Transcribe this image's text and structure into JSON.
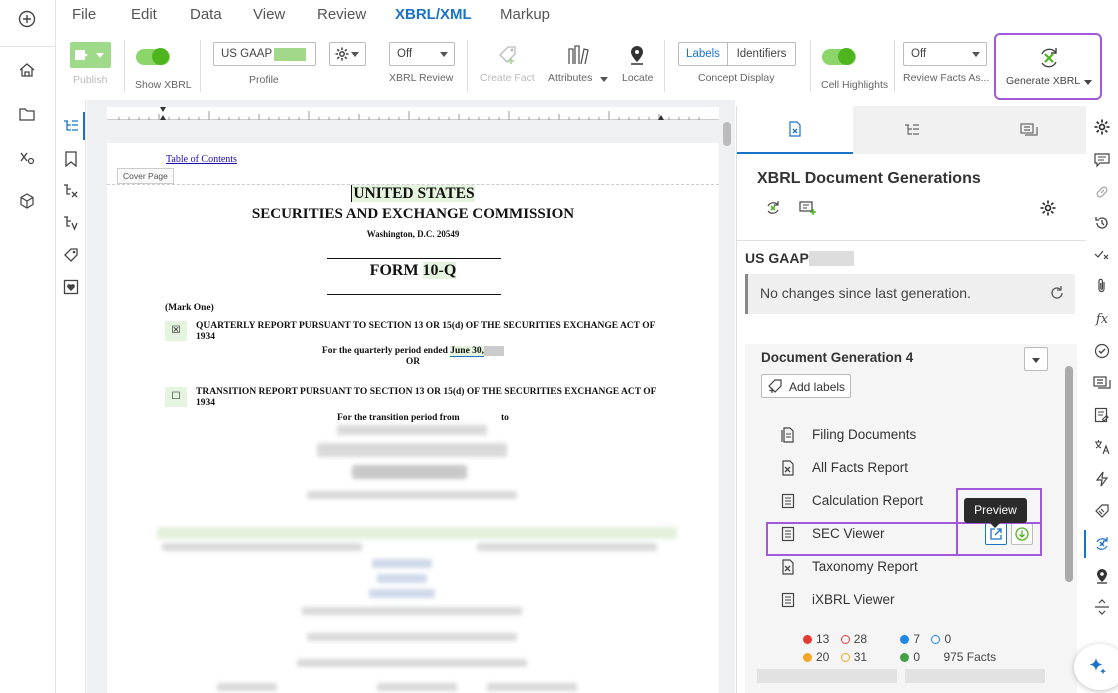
{
  "menubar": {
    "items": [
      "File",
      "Edit",
      "Data",
      "View",
      "Review",
      "XBRL/XML",
      "Markup"
    ],
    "active": "XBRL/XML"
  },
  "ribbon": {
    "publish_label": "Publish",
    "show_xbrl_label": "Show XBRL",
    "profile_value": "US GAAP",
    "profile_label": "Profile",
    "xbrl_review_value": "Off",
    "xbrl_review_label": "XBRL Review",
    "create_fact_label": "Create Fact",
    "attributes_label": "Attributes",
    "locate_label": "Locate",
    "concept_display_labels": "Labels",
    "concept_display_identifiers": "Identifiers",
    "concept_display_label": "Concept Display",
    "cell_highlights_label": "Cell Highlights",
    "review_facts_value": "Off",
    "review_facts_label": "Review Facts As...",
    "generate_xbrl_label": "Generate XBRL"
  },
  "document": {
    "toc_link": "Table of Contents",
    "cover_page_tag": "Cover Page",
    "heading1": "UNITED STATES",
    "heading2": "SECURITIES AND EXCHANGE COMMISSION",
    "location": "Washington, D.C. 20549",
    "form_prefix": "FORM ",
    "form_type": "10-Q",
    "mark_one": "(Mark One)",
    "checked_box": "☒",
    "unchecked_box": "☐",
    "quarterly_report": "QUARTERLY REPORT PURSUANT TO SECTION 13 OR 15(d) OF THE SECURITIES EXCHANGE ACT OF 1934",
    "quarterly_period": "For the quarterly period ended ",
    "period_date": "June 30,",
    "or": "OR",
    "transition_report": "TRANSITION REPORT PURSUANT TO SECTION 13 OR 15(d) OF THE SECURITIES EXCHANGE ACT OF 1934",
    "transition_period": "For the transition period from",
    "to": "to"
  },
  "panel": {
    "title": "XBRL Document Generations",
    "profile": "US GAAP",
    "status_message": "No changes since last generation.",
    "generation_title": "Document Generation 4",
    "add_labels": "Add labels",
    "reports": [
      "Filing Documents",
      "All Facts Report",
      "Calculation Report",
      "SEC Viewer",
      "Taxonomy Report",
      "iXBRL Viewer"
    ],
    "tooltip": "Preview",
    "stats": {
      "red_filled": "13",
      "red_outline": "28",
      "blue_filled": "7",
      "blue_outline": "0",
      "orange_filled": "20",
      "orange_outline": "31",
      "green_filled": "0",
      "facts": "975 Facts"
    }
  },
  "colors": {
    "accent": "#1a73c9",
    "highlight": "#a259d9",
    "toggle_green": "#4eb51f",
    "red": "#e53935",
    "blue": "#1e88e5",
    "orange": "#f5a623",
    "green": "#43a047"
  }
}
